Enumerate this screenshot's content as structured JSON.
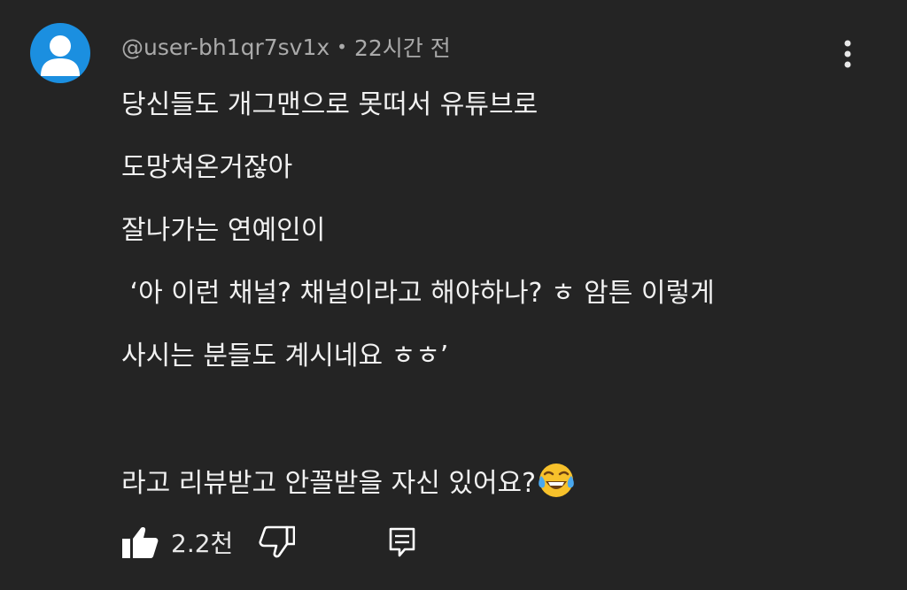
{
  "comment": {
    "author": "@user-bh1qr7sv1x",
    "separator": "•",
    "time": "22시간 전",
    "lines": [
      "당신들도 개그맨으로 못떠서 유튜브로",
      "도망쳐온거잖아",
      "잘나가는 연예인이",
      " ‘아 이런 채널? 채널이라고 해야하나? ㅎ 암튼 이렇게",
      "사시는 분들도 계시네요 ㅎㅎ’",
      "",
      "라고 리뷰받고 안꼴받을 자신 있어요?"
    ],
    "emoji": "face-with-tears-of-joy"
  },
  "actions": {
    "like_count": "2.2천",
    "icons": [
      "thumbs-up-icon",
      "thumbs-down-icon",
      "reply-icon"
    ]
  },
  "colors": {
    "background": "#242424",
    "text": "#f1f1f1",
    "meta": "#aaaaaa",
    "avatar": "#1b8fe0"
  }
}
